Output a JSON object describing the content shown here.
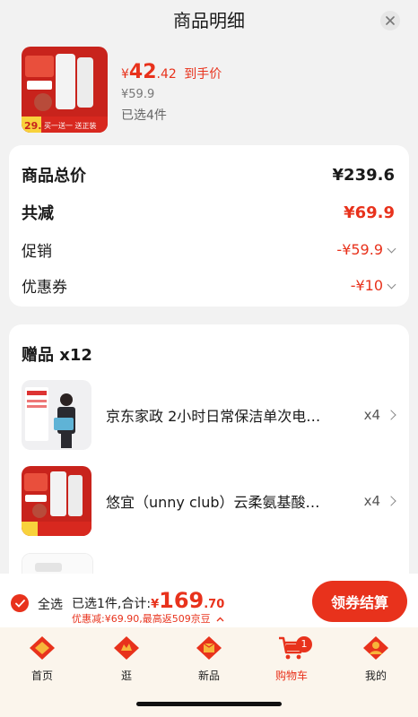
{
  "header": {
    "title": "商品明细"
  },
  "product": {
    "currency": "¥",
    "price_main": "42",
    "price_decimal": ".42",
    "price_tag": "到手价",
    "original_price": "¥59.9",
    "selected_count": "已选4件",
    "image_badge": "29.9",
    "image_caption": "买一送一 送正装"
  },
  "summary": {
    "total_label": "商品总价",
    "total_value": "¥239.6",
    "reduce_label": "共减",
    "reduce_value": "¥69.9",
    "promo_label": "促销",
    "promo_value": "-¥59.9",
    "coupon_label": "优惠券",
    "coupon_value": "-¥10"
  },
  "gifts": {
    "title": "赠品 x12",
    "items": [
      {
        "name": "京东家政 2小时日常保洁单次电…",
        "qty": "x4"
      },
      {
        "name": "悠宜（unny club）云柔氨基酸…",
        "qty": "x4"
      }
    ]
  },
  "checkout_bar": {
    "select_all": "全选",
    "summary_prefix": "已选1件,合计:",
    "currency": "¥",
    "total_main": "169",
    "total_decimal": ".70",
    "discount_text": "优惠减:¥69.90,最高返509京豆",
    "checkout_label": "领券结算"
  },
  "tabbar": {
    "tabs": [
      {
        "label": "首页",
        "icon": "home-icon"
      },
      {
        "label": "逛",
        "icon": "browse-icon"
      },
      {
        "label": "新品",
        "icon": "new-products-icon"
      },
      {
        "label": "购物车",
        "icon": "cart-icon",
        "badge": "1",
        "active": true
      },
      {
        "label": "我的",
        "icon": "profile-icon"
      }
    ]
  },
  "colors": {
    "accent": "#e8321c",
    "background": "#f2f2f2",
    "tabbar_bg": "#fbf5ec"
  }
}
